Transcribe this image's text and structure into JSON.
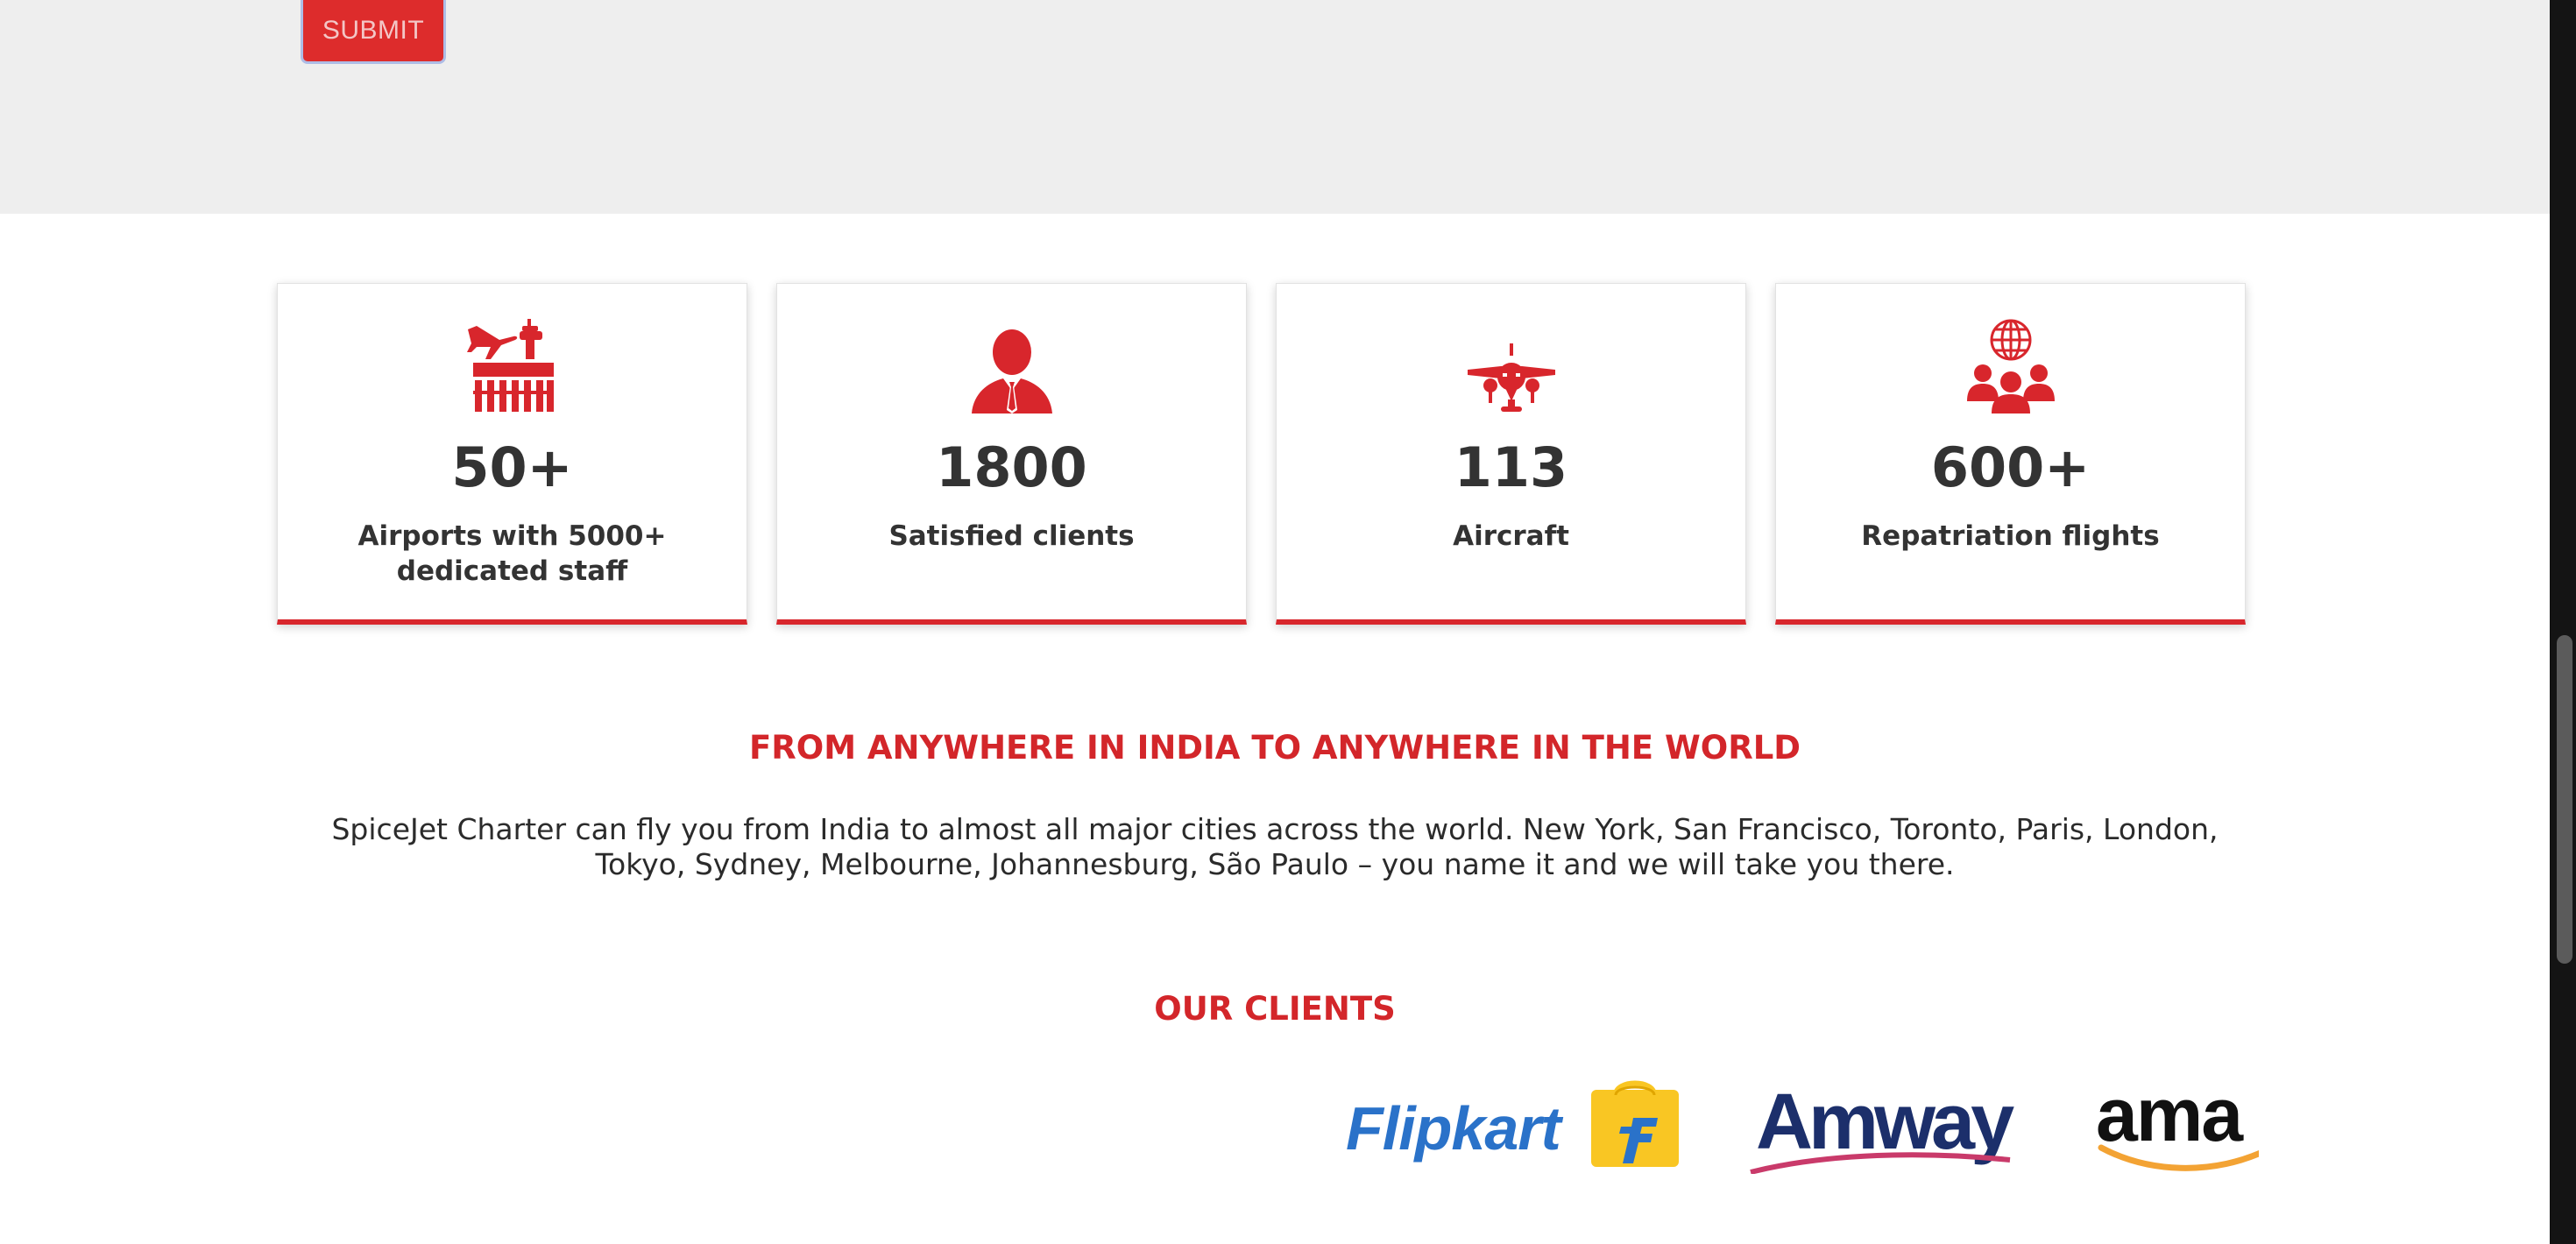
{
  "form": {
    "submit_label": "SUBMIT"
  },
  "stats": [
    {
      "icon": "airport-icon",
      "value": "50+",
      "label": "Airports with 5000+ dedicated staff"
    },
    {
      "icon": "client-icon",
      "value": "1800",
      "label": "Satisfied clients"
    },
    {
      "icon": "aircraft-icon",
      "value": "113",
      "label": "Aircraft"
    },
    {
      "icon": "global-group-icon",
      "value": "600+",
      "label": "Repatriation flights"
    }
  ],
  "destinations": {
    "title": "FROM ANYWHERE IN INDIA TO ANYWHERE IN THE WORLD",
    "text": "SpiceJet Charter can fly you from India to almost all major cities across the world. New York, San Francisco, Toronto, Paris, London, Tokyo, Sydney, Melbourne, Johannesburg, São Paulo – you name it and we will take you there."
  },
  "clients": {
    "title": "OUR CLIENTS",
    "logos": [
      "Flipkart",
      "Amway",
      "ama"
    ]
  },
  "colors": {
    "accent": "#d8262c",
    "band": "#eeeeee",
    "text": "#333333"
  }
}
